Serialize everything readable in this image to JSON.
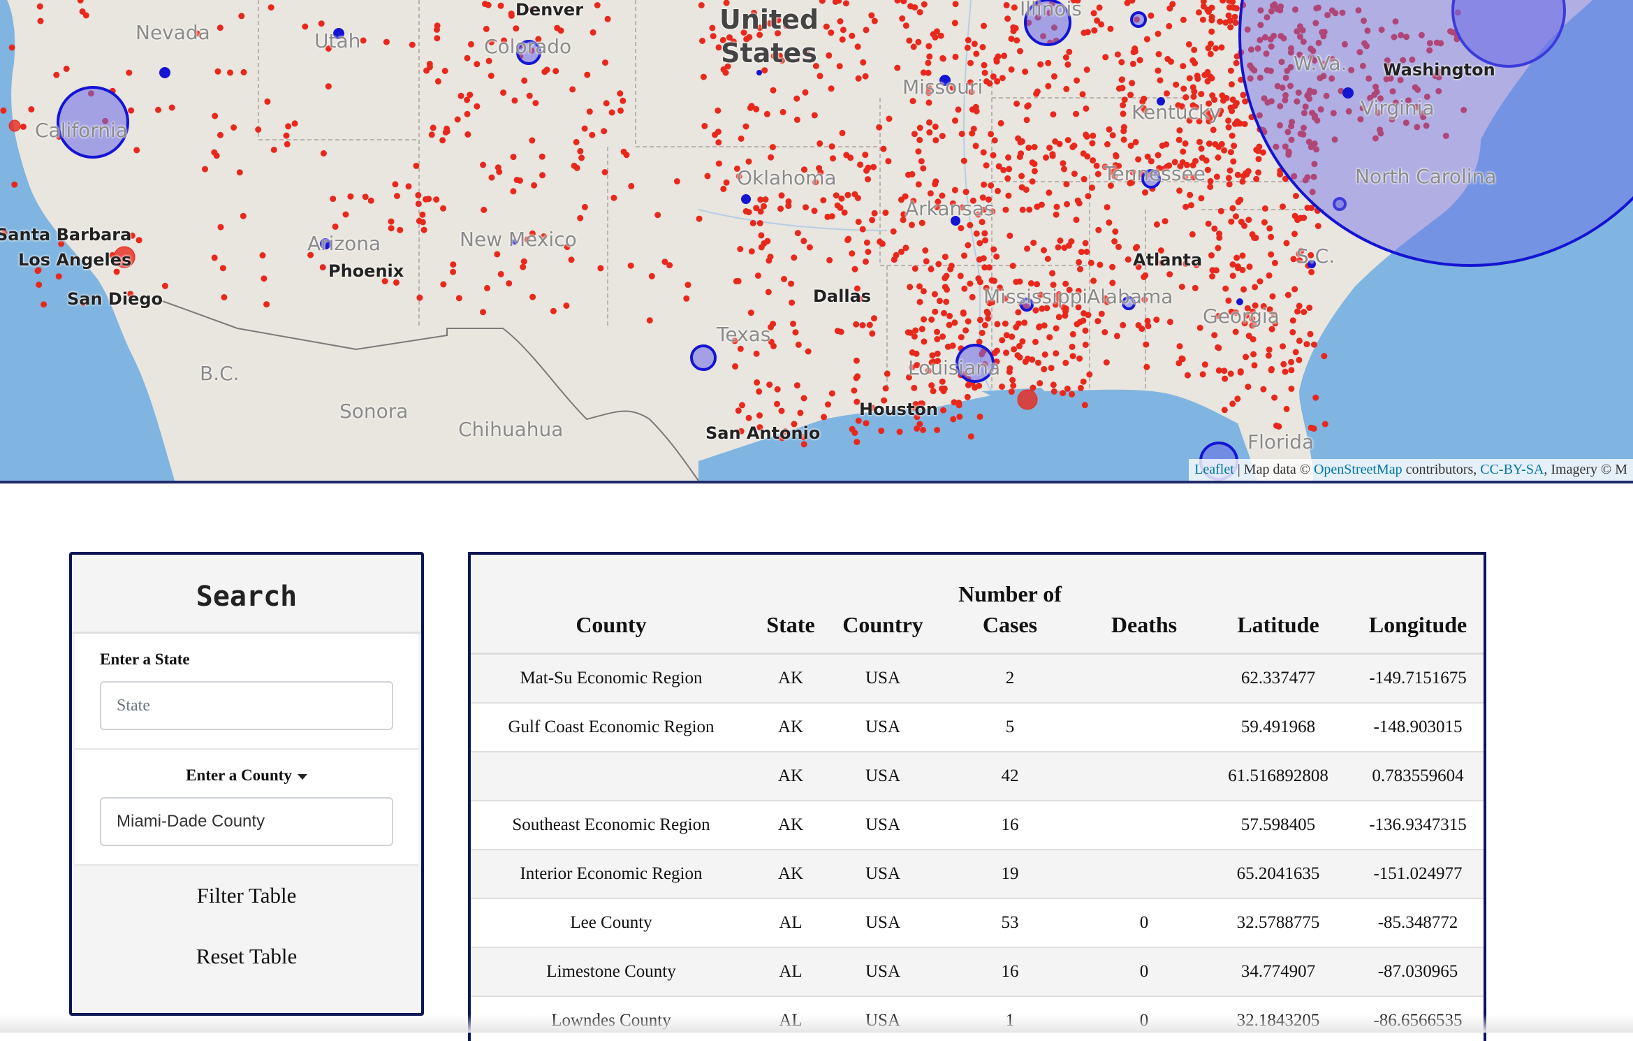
{
  "map": {
    "country_label_line1": "United",
    "country_label_line2": "States",
    "states": [
      "Nevada",
      "Utah",
      "Colorado",
      "California",
      "Arizona",
      "New Mexico",
      "Oklahoma",
      "Texas",
      "Arkansas",
      "Missouri",
      "Louisiana",
      "Mississippi",
      "Alabama",
      "Georgia",
      "Tennessee",
      "Kentucky",
      "W.Va.",
      "Virginia",
      "North Carolina",
      "S.C.",
      "Florida",
      "Illinois",
      "B.C.",
      "Sonora",
      "Chihuahua"
    ],
    "cities": [
      "Denver",
      "Santa Barbara",
      "Los Angeles",
      "San Diego",
      "Phoenix",
      "Dallas",
      "Houston",
      "San Antonio",
      "Atlanta",
      "Washington"
    ],
    "attribution": {
      "leaflet": "Leaflet",
      "sep1": " | Map data © ",
      "osm": "OpenStreetMap",
      "contributors": " contributors, ",
      "license": "CC-BY-SA",
      "imagery": ", Imagery © M"
    },
    "colors": {
      "cases_dot": "#e8281c",
      "cluster_stroke": "#1414d2",
      "cluster_fill": "#6a6ae6",
      "water": "#7fb5e0",
      "land": "#e9e5df"
    }
  },
  "search": {
    "title": "Search",
    "state_label": "Enter a State",
    "state_placeholder": "State",
    "county_label": "Enter a County",
    "county_value": "Miami-Dade County",
    "filter_button": "Filter Table",
    "reset_button": "Reset Table"
  },
  "table": {
    "headers": {
      "county": "County",
      "state": "State",
      "country": "Country",
      "cases_line1": "Number of",
      "cases_line2": "Cases",
      "deaths": "Deaths",
      "latitude": "Latitude",
      "longitude": "Longitude"
    },
    "rows": [
      {
        "county": "Mat-Su Economic Region",
        "state": "AK",
        "country": "USA",
        "cases": "2",
        "deaths": "",
        "lat": "62.337477",
        "lon": "-149.7151675"
      },
      {
        "county": "Gulf Coast Economic Region",
        "state": "AK",
        "country": "USA",
        "cases": "5",
        "deaths": "",
        "lat": "59.491968",
        "lon": "-148.903015"
      },
      {
        "county": "",
        "state": "AK",
        "country": "USA",
        "cases": "42",
        "deaths": "",
        "lat": "61.516892808",
        "lon": "0.783559604"
      },
      {
        "county": "Southeast Economic Region",
        "state": "AK",
        "country": "USA",
        "cases": "16",
        "deaths": "",
        "lat": "57.598405",
        "lon": "-136.9347315"
      },
      {
        "county": "Interior Economic Region",
        "state": "AK",
        "country": "USA",
        "cases": "19",
        "deaths": "",
        "lat": "65.2041635",
        "lon": "-151.024977"
      },
      {
        "county": "Lee County",
        "state": "AL",
        "country": "USA",
        "cases": "53",
        "deaths": "0",
        "lat": "32.5788775",
        "lon": "-85.348772"
      },
      {
        "county": "Limestone County",
        "state": "AL",
        "country": "USA",
        "cases": "16",
        "deaths": "0",
        "lat": "34.774907",
        "lon": "-87.030965"
      },
      {
        "county": "Lowndes County",
        "state": "AL",
        "country": "USA",
        "cases": "1",
        "deaths": "0",
        "lat": "32.1843205",
        "lon": "-86.6566535"
      }
    ]
  }
}
